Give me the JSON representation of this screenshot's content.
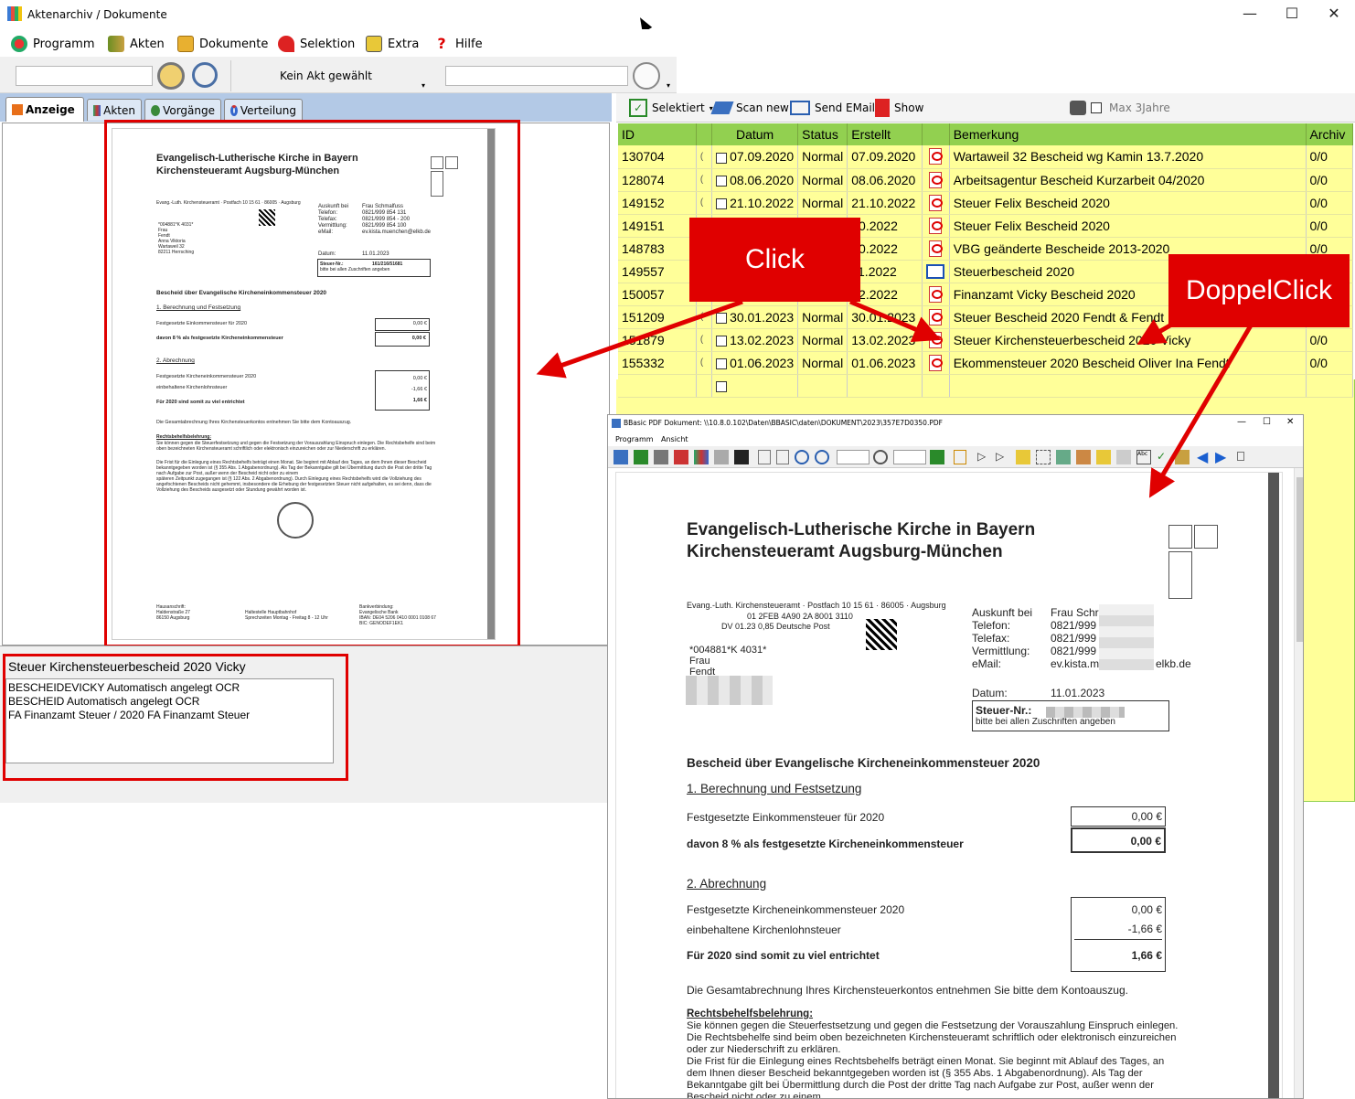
{
  "window": {
    "title": "Aktenarchiv / Dokumente"
  },
  "menu": [
    {
      "label": "Programm",
      "icon": "program-icon"
    },
    {
      "label": "Akten",
      "icon": "files-icon"
    },
    {
      "label": "Dokumente",
      "icon": "folder-icon"
    },
    {
      "label": "Selektion",
      "icon": "pin-icon"
    },
    {
      "label": "Extra",
      "icon": "extra-icon"
    },
    {
      "label": "Hilfe",
      "icon": "help-icon"
    }
  ],
  "toolbar": {
    "akt_status": "Kein Akt gewählt"
  },
  "tabs": [
    {
      "label": "Anzeige",
      "active": true
    },
    {
      "label": "Akten",
      "active": false
    },
    {
      "label": "Vorgänge",
      "active": false
    },
    {
      "label": "Verteilung",
      "active": false
    }
  ],
  "right_toolbar": {
    "selected": "Selektiert",
    "scan": "Scan new",
    "email": "Send EMail",
    "show": "Show",
    "max3": "Max 3Jahre"
  },
  "grid": {
    "headers": [
      "ID",
      "",
      "Datum",
      "Status",
      "Erstellt",
      "",
      "Bemerkung",
      "Archiv"
    ],
    "rows": [
      {
        "id": "130704",
        "datum": "07.09.2020",
        "status": "Normal",
        "erstellt": "07.09.2020",
        "icon": "pdf",
        "bemerkung": "Wartaweil 32 Bescheid wg Kamin 13.7.2020",
        "archiv": "0/0"
      },
      {
        "id": "128074",
        "datum": "08.06.2020",
        "status": "Normal",
        "erstellt": "08.06.2020",
        "icon": "pdf",
        "bemerkung": "Arbeitsagentur Bescheid Kurzarbeit 04/2020",
        "archiv": "0/0"
      },
      {
        "id": "149152",
        "datum": "21.10.2022",
        "status": "Normal",
        "erstellt": "21.10.2022",
        "icon": "pdf",
        "bemerkung": "Steuer Felix Bescheid 2020",
        "archiv": "0/0"
      },
      {
        "id": "149151",
        "datum": "",
        "status": "",
        "erstellt": "10.2022",
        "icon": "pdf",
        "bemerkung": "Steuer Felix Bescheid 2020",
        "archiv": "0/0"
      },
      {
        "id": "148783",
        "datum": "",
        "status": "",
        "erstellt": "10.2022",
        "icon": "pdf",
        "bemerkung": "VBG geänderte Bescheide 2013-2020",
        "archiv": "0/0"
      },
      {
        "id": "149557",
        "datum": "",
        "status": "",
        "erstellt": "11.2022",
        "icon": "mail",
        "bemerkung": "Steuerbescheid 2020",
        "archiv": ""
      },
      {
        "id": "150057",
        "datum": "",
        "status": "",
        "erstellt": "12.2022",
        "icon": "pdf",
        "bemerkung": "Finanzamt Vicky Bescheid 2020",
        "archiv": ""
      },
      {
        "id": "151209",
        "datum": "30.01.2023",
        "status": "Normal",
        "erstellt": "30.01.2023",
        "icon": "pdf",
        "bemerkung": "Steuer Bescheid 2020 Fendt & Fendt",
        "archiv": ""
      },
      {
        "id": "151879",
        "datum": "13.02.2023",
        "status": "Normal",
        "erstellt": "13.02.2023",
        "icon": "pdf",
        "bemerkung": "Steuer Kirchensteuerbescheid 2020 Vicky",
        "archiv": "0/0"
      },
      {
        "id": "155332",
        "datum": "01.06.2023",
        "status": "Normal",
        "erstellt": "01.06.2023",
        "icon": "pdf",
        "bemerkung": "Ekommensteuer 2020 Bescheid Oliver Ina Fendt",
        "archiv": "0/0"
      }
    ]
  },
  "notes": {
    "title": "Steuer Kirchensteuerbescheid 2020 Vicky",
    "lines": [
      "BESCHEIDEVICKY Automatisch angelegt OCR",
      "BESCHEID Automatisch angelegt OCR",
      "FA Finanzamt Steuer / 2020 FA Finanzamt Steuer"
    ]
  },
  "callouts": {
    "click": "Click",
    "doubleclick": "DoppelClick"
  },
  "pdf_viewer": {
    "title": "BBasic PDF Dokument: \\\\10.8.0.102\\Daten\\BBASIC\\daten\\DOKUMENT\\2023\\357E7D0350.PDF",
    "menu": [
      "Programm",
      "Ansicht"
    ]
  },
  "document": {
    "heading1": "Evangelisch-Lutherische Kirche in Bayern",
    "heading2": "Kirchensteueramt Augsburg-München",
    "sender": "Evang.-Luth. Kirchensteueramt · Postfach 10 15 61 · 86005 · Augsburg",
    "code": "01 2FEB 4A90 2A 8001 3110",
    "dv": "DV 01.23     0,85   Deutsche Post",
    "recipient": [
      "*004881*K 4031*",
      "Frau",
      "Fendt"
    ],
    "info_labels": [
      "Auskunft bei",
      "Telefon:",
      "Telefax:",
      "Vermittlung:",
      "eMail:"
    ],
    "info_values": [
      "Frau Schr",
      "0821/999",
      "0821/999",
      "0821/999",
      "ev.kista.m"
    ],
    "email_tail": "elkb.de",
    "datum_label": "Datum:",
    "datum_value": "11.01.2023",
    "steuer_nr_label": "Steuer-Nr.:",
    "steuer_nr_note": "bitte bei allen Zuschriften angeben",
    "bescheid_title": "Bescheid über Evangelische Kircheneinkommensteuer 2020",
    "section1": "1. Berechnung und Festsetzung",
    "line1": "Festgesetzte Einkommensteuer für 2020",
    "line1_val": "0,00 €",
    "line2": "davon 8 % als festgesetzte Kircheneinkommensteuer",
    "line2_val": "0,00 €",
    "section2": "2. Abrechnung",
    "line3": "Festgesetzte Kircheneinkommensteuer 2020",
    "line3_val": "0,00 €",
    "line4": "einbehaltene Kirchenlohnsteuer",
    "line4_val": "-1,66 €",
    "line5": "Für 2020 sind somit zu viel entrichtet",
    "line5_val": "1,66 €",
    "gesamt": "Die Gesamtabrechnung Ihres Kirchensteuerkontos entnehmen Sie bitte dem Kontoauszug.",
    "rb_title": "Rechtsbehelfsbelehrung:",
    "rb_text": "Sie können gegen die Steuerfestsetzung und gegen die Festsetzung der Vorauszahlung Einspruch einlegen. Die Rechtsbehelfe sind beim oben bezeichneten Kirchensteueramt schriftlich oder elektronisch einzureichen oder zur Niederschrift zu erklären.",
    "rb_text2": "Die Frist für die Einlegung eines Rechtsbehelfs beträgt einen Monat. Sie beginnt mit Ablauf des Tages, an dem Ihnen dieser Bescheid bekanntgegeben worden ist (§ 355 Abs. 1 Abgabenordnung). Als Tag der Bekanntgabe gilt bei Übermittlung durch die Post der dritte Tag nach Aufgabe zur Post, außer wenn der Bescheid nicht oder zu einem",
    "rb_text2_tail": "späteren Zeitpunkt zugegangen ist (§ 122 Abs. 2 Abgabenordnung). Durch Einlegung eines Rechtsbehelfs wird die Vollziehung des angefochtenen Bescheids nicht gehemmt, insbesondere die Erhebung der festgesetzten Steuer nicht aufgehalten, es sei denn, dass die Vollziehung des Bescheids ausgesetzt oder Stundung gewährt worden ist.",
    "footer_left": [
      "Hausanschrift:",
      "Haldenstraße 27",
      "86150 Augsburg"
    ],
    "footer_mid": [
      "Haltestelle Hauptbahnhof",
      "Sprechzeiten Montag - Freitag 8 - 12 Uhr"
    ],
    "footer_right": [
      "Bankverbindung:",
      "Evangelische Bank",
      "IBAN: DE04 5206 0410 0001 0108 67",
      "BIC: GENODEF1EK1"
    ],
    "thumb_info_values": [
      "Frau Schmalfuss",
      "0821/999 854 131",
      "0821/999 854 - 200",
      "0821/999 854 100",
      "ev.kista.muenchen@elkb.de"
    ],
    "thumb_recipient": [
      "*004881*K 4031*",
      "Frau",
      "Fendt",
      "Anna Viktoria",
      "Wartaweil 32",
      "82211 Herrsching"
    ],
    "thumb_steuer_nr": "161/216/51681"
  }
}
